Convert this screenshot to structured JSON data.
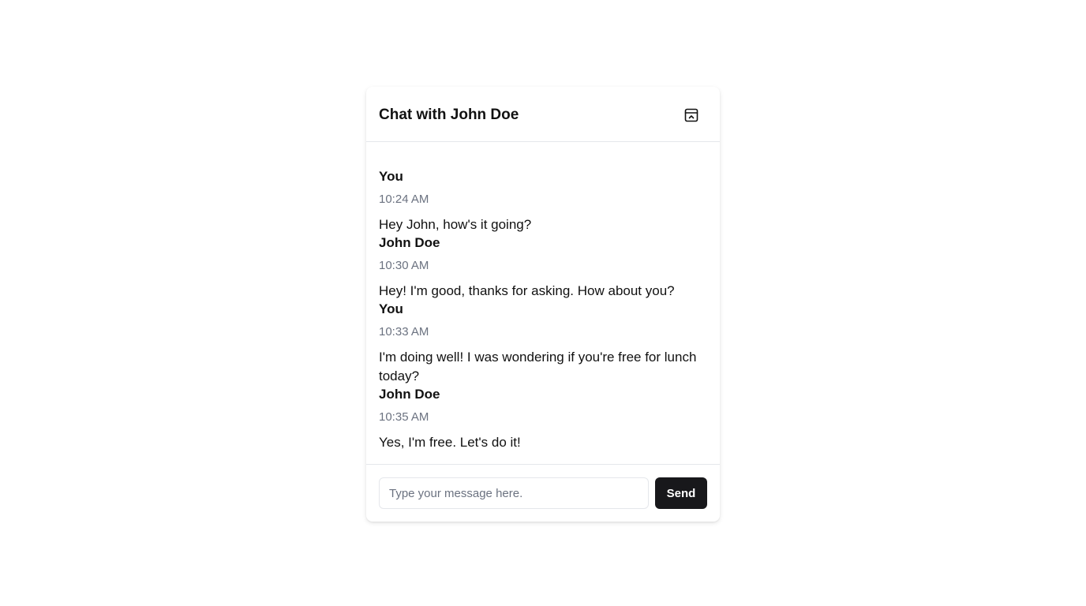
{
  "header": {
    "title": "Chat with John Doe",
    "action_icon": "window-collapse-icon"
  },
  "messages": [
    {
      "sender": "You",
      "time": "10:24 AM",
      "text": "Hey John, how's it going?"
    },
    {
      "sender": "John Doe",
      "time": "10:30 AM",
      "text": "Hey! I'm good, thanks for asking. How about you?"
    },
    {
      "sender": "You",
      "time": "10:33 AM",
      "text": "I'm doing well! I was wondering if you're free for lunch today?"
    },
    {
      "sender": "John Doe",
      "time": "10:35 AM",
      "text": "Yes, I'm free. Let's do it!"
    }
  ],
  "composer": {
    "placeholder": "Type your message here.",
    "value": "",
    "send_label": "Send"
  },
  "colors": {
    "text": "#111111",
    "muted": "#6b7280",
    "border": "#e5e7eb",
    "button_bg": "#18181b",
    "button_text": "#ffffff"
  }
}
